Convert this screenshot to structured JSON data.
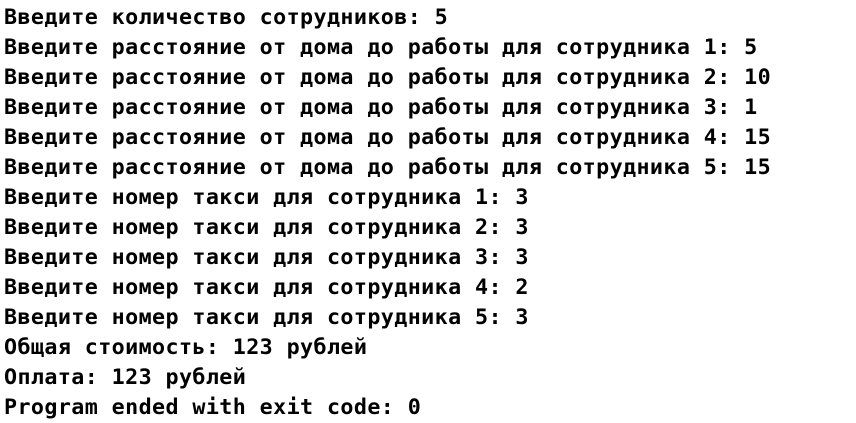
{
  "console": {
    "lines": [
      "Введите количество сотрудников: 5",
      "Введите расстояние от дома до работы для сотрудника 1: 5",
      "Введите расстояние от дома до работы для сотрудника 2: 10",
      "Введите расстояние от дома до работы для сотрудника 3: 1",
      "Введите расстояние от дома до работы для сотрудника 4: 15",
      "Введите расстояние от дома до работы для сотрудника 5: 15",
      "Введите номер такси для сотрудника 1: 3",
      "Введите номер такси для сотрудника 2: 3",
      "Введите номер такси для сотрудника 3: 3",
      "Введите номер такси для сотрудника 4: 2",
      "Введите номер такси для сотрудника 5: 3",
      "Общая стоимость: 123 рублей",
      "Оплата: 123 рублей",
      "Program ended with exit code: 0"
    ]
  },
  "colors": {
    "background": "#ffffff",
    "text": "#000000"
  }
}
